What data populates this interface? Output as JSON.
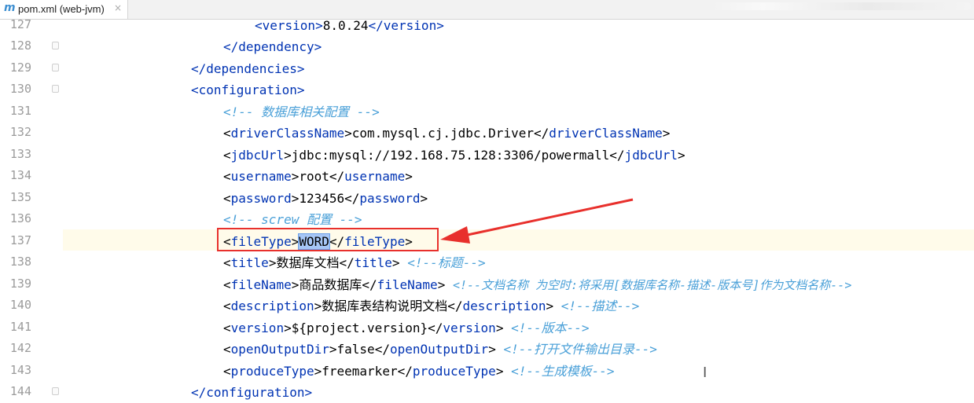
{
  "tab": {
    "icon": "m",
    "title": "pom.xml (web-jvm)",
    "close": "×"
  },
  "line_numbers": [
    "127",
    "128",
    "129",
    "130",
    "131",
    "132",
    "133",
    "134",
    "135",
    "136",
    "137",
    "138",
    "139",
    "140",
    "141",
    "142",
    "143",
    "144"
  ],
  "code": {
    "l127": {
      "open": "<version>",
      "text": "8.0.24",
      "close": "</version>"
    },
    "l128": {
      "tag": "</dependency>"
    },
    "l129": {
      "tag": "</dependencies>"
    },
    "l130": {
      "tag": "<configuration>"
    },
    "l131": {
      "comment": "<!-- 数据库相关配置 -->"
    },
    "l132": {
      "open_lt": "<",
      "open": "driverClassName",
      "open_gt": ">",
      "text": "com.mysql.cj.jdbc.Driver",
      "close_lt": "</",
      "close": "driverClassName",
      "close_gt": ">"
    },
    "l133": {
      "open_lt": "<",
      "open": "jdbcUrl",
      "open_gt": ">",
      "text": "jdbc:mysql://192.168.75.128:3306/powermall",
      "close_lt": "</",
      "close": "jdbcUrl",
      "close_gt": ">"
    },
    "l134": {
      "open_lt": "<",
      "open": "username",
      "open_gt": ">",
      "text": "root",
      "close_lt": "</",
      "close": "username",
      "close_gt": ">"
    },
    "l135": {
      "open_lt": "<",
      "open": "password",
      "open_gt": ">",
      "text": "123456",
      "close_lt": "</",
      "close": "password",
      "close_gt": ">"
    },
    "l136": {
      "comment": "<!-- screw 配置 -->"
    },
    "l137": {
      "open_lt": "<",
      "open": "fileType",
      "open_gt": ">",
      "text": "WORD",
      "close_lt": "</",
      "close": "fileType",
      "close_gt": ">"
    },
    "l138": {
      "open_lt": "<",
      "open": "title",
      "open_gt": ">",
      "text": "数据库文档",
      "close_lt": "</",
      "close": "title",
      "close_gt": ">",
      "comment": "<!--标题-->"
    },
    "l139": {
      "open_lt": "<",
      "open": "fileName",
      "open_gt": ">",
      "text": "商品数据库",
      "close_lt": "</",
      "close": "fileName",
      "close_gt": ">",
      "comment": "<!--文档名称 为空时:将采用[数据库名称-描述-版本号]作为文档名称-->"
    },
    "l140": {
      "open_lt": "<",
      "open": "description",
      "open_gt": ">",
      "text": "数据库表结构说明文档",
      "close_lt": "</",
      "close": "description",
      "close_gt": ">",
      "comment": "<!--描述-->"
    },
    "l141": {
      "open_lt": "<",
      "open": "version",
      "open_gt": ">",
      "text": "${project.version}",
      "close_lt": "</",
      "close": "version",
      "close_gt": ">",
      "comment": "<!--版本-->"
    },
    "l142": {
      "open_lt": "<",
      "open": "openOutputDir",
      "open_gt": ">",
      "text": "false",
      "close_lt": "</",
      "close": "openOutputDir",
      "close_gt": ">",
      "comment": "<!--打开文件输出目录-->"
    },
    "l143": {
      "open_lt": "<",
      "open": "produceType",
      "open_gt": ">",
      "text": "freemarker",
      "close_lt": "</",
      "close": "produceType",
      "close_gt": ">",
      "comment": "<!--生成模板-->"
    },
    "l144": {
      "tag": "</configuration>"
    }
  },
  "colors": {
    "tag": "#0033b3",
    "comment": "#4aa0d8",
    "annotation": "#e8302c",
    "selection": "#a6c6f5"
  },
  "icons": {
    "tab_icon": "maven-icon",
    "close": "close-icon",
    "cursor": "text-cursor-icon"
  }
}
